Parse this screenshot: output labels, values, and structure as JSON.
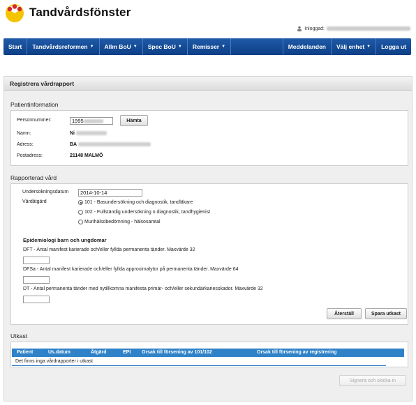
{
  "header": {
    "brand": "Tandvårdsfönster",
    "login_label": "Inloggad:"
  },
  "nav": {
    "start": "Start",
    "tandvardsreformen": "Tandvårdsreformen",
    "allm_bou": "Allm BoU",
    "spec_bou": "Spec BoU",
    "remisser": "Remisser",
    "meddelanden": "Meddelanden",
    "valj_enhet": "Välj enhet",
    "logga_ut": "Logga ut"
  },
  "page": {
    "title": "Registrera vårdrapport"
  },
  "patient": {
    "section_title": "Patientinformation",
    "personnummer_label": "Personnummer:",
    "personnummer_value": "1995",
    "hamta_label": "Hämta",
    "namn_label": "Namn:",
    "namn_value": "Ni",
    "adress_label": "Adress:",
    "adress_value": "BA",
    "postadress_label": "Postadress:",
    "postadress_value": "21148 MALMÖ"
  },
  "rapporterad": {
    "section_title": "Rapporterad vård",
    "datum_label": "Undersökningsdatum",
    "datum_value": "2014-10-14",
    "vardatgard_label": "Vårdåtgärd",
    "options": [
      {
        "label": "101 - Basundersökning och diagnostik, tandläkare",
        "checked": true
      },
      {
        "label": "102 - Fullständig undersökning o diagnostik, tandhygienist",
        "checked": false
      },
      {
        "label": "Munhälsobedömning - hälsosamtal",
        "checked": false
      }
    ],
    "epi_title": "Epidemiologi barn och ungdomar",
    "dft_label": "DFT - Antal manifest karierade och/eller fyllda permanenta tänder. Maxvärde 32",
    "dfsa_label": "DFSa - Antal manifest karierade och/eller fyllda approximalytor på permanenta tänder. Maxvärde 64",
    "dt_label": "DT - Antal permanenta tänder med nytillkomna manifesta primär- och/eller sekundärkariesskador. Maxvärde 32",
    "aterstall_label": "Återställ",
    "spara_label": "Spara utkast"
  },
  "utkast": {
    "section_title": "Utkast",
    "columns": [
      "Patient",
      "Us.datum",
      "Åtgärd",
      "EPI",
      "Orsak till försening av 101/102",
      "Orsak till försening av registrering"
    ],
    "empty_text": "Det finns inga vårdrapporter i utkast",
    "signera_label": "Signera och skicka in"
  },
  "colors": {
    "nav_blue": "#0d3f86",
    "table_blue": "#2f82c8",
    "logo_yellow": "#f5c400",
    "logo_red": "#d8262d"
  }
}
